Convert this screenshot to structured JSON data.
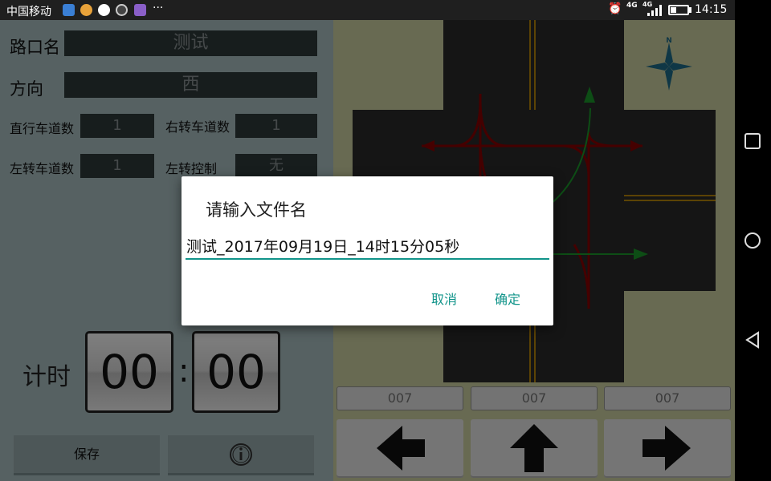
{
  "status_bar": {
    "carrier": "中国移动",
    "more": "···",
    "alarm": "⏰",
    "net1": "4G",
    "net2": "4G",
    "time": "14:15"
  },
  "form": {
    "intersection_label": "路口名",
    "intersection_value": "测试",
    "direction_label": "方向",
    "direction_value": "西",
    "straight_lanes_label": "直行车道数",
    "straight_lanes_value": "1",
    "right_lanes_label": "右转车道数",
    "right_lanes_value": "1",
    "left_lanes_label": "左转车道数",
    "left_lanes_value": "1",
    "left_control_label": "左转控制",
    "left_control_value": "无"
  },
  "timer": {
    "label": "计时",
    "minutes": "00",
    "separator": ":",
    "seconds": "00"
  },
  "buttons": {
    "save": "保存"
  },
  "map": {
    "compass_label": "N"
  },
  "counters": {
    "left": "007",
    "straight": "007",
    "right": "007"
  },
  "dialog": {
    "title": "请输入文件名",
    "filename": "测试_2017年09月19日_14时15分05秒",
    "cancel": "取消",
    "confirm": "确定"
  },
  "colors": {
    "accent": "#11948a",
    "panel": "#acc3c5",
    "map_bg": "#d1d4a5",
    "road": "#2b2b2b",
    "path_red": "#8b0000",
    "path_green": "#1b9a2a"
  }
}
